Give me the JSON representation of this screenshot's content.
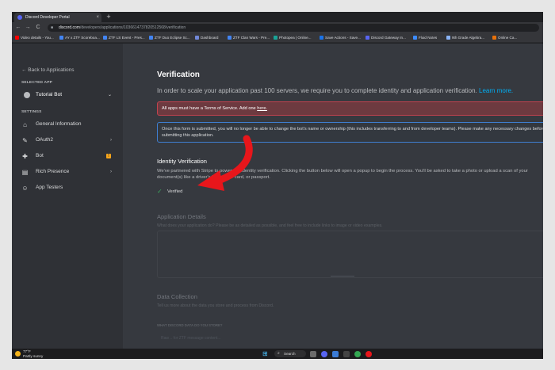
{
  "browser": {
    "tab_title": "Discord Developer Portal",
    "tab_close": "×",
    "new_tab": "+",
    "back": "←",
    "forward": "→",
    "reload": "C",
    "url_host": "discord.com",
    "url_path": "/developers/applications/1036614737820512568/verification",
    "bookmarks": [
      {
        "label": "Video details - You...",
        "color": "#ff0000"
      },
      {
        "label": "AY x ZTF Scoreboa...",
        "color": "#4285f4"
      },
      {
        "label": "ZTF LS Event - Pres...",
        "color": "#4285f4"
      },
      {
        "label": "ZTF Duo Eclipse Sc...",
        "color": "#4285f4"
      },
      {
        "label": "Dashboard",
        "color": "#7289da"
      },
      {
        "label": "ZTF Clan Wars - Pre...",
        "color": "#4285f4"
      },
      {
        "label": "Photopea | Online...",
        "color": "#18a497"
      },
      {
        "label": "Save Actions - Save...",
        "color": "#1a73e8"
      },
      {
        "label": "Discord Gateway In...",
        "color": "#5865f2"
      },
      {
        "label": "Fluid Notes",
        "color": "#3c8cff"
      },
      {
        "label": "9th Grade Algebra...",
        "color": "#8ab4f8"
      },
      {
        "label": "Online Ca...",
        "color": "#e8710a"
      }
    ]
  },
  "sidebar": {
    "back_label": "← Back to Applications",
    "selected_app_label": "SELECTED APP",
    "app_name": "Tutorial Bot",
    "settings_label": "SETTINGS",
    "items": [
      {
        "label": "General Information",
        "icon": "home-icon",
        "glyph": "⌂",
        "arrow": ""
      },
      {
        "label": "OAuth2",
        "icon": "wrench-icon",
        "glyph": "✎",
        "arrow": "›"
      },
      {
        "label": "Bot",
        "icon": "puzzle-icon",
        "glyph": "✚",
        "arrow": "",
        "warn": "!"
      },
      {
        "label": "Rich Presence",
        "icon": "document-icon",
        "glyph": "▤",
        "arrow": "›"
      },
      {
        "label": "App Testers",
        "icon": "person-icon",
        "glyph": "☺",
        "arrow": ""
      }
    ]
  },
  "main": {
    "title": "Verification",
    "intro": "In order to scale your application past 100 servers, we require you to complete identity and application verification.",
    "learn_more": "Learn more.",
    "alert_text": "All apps must have a Terms of Service. Add one ",
    "alert_link": "here.",
    "notice": "Once this form is submitted, you will no longer be able to change the bot's name or ownership (this includes transferring to and from developer teams). Please make any necessary changes before submitting this application.",
    "identity_title": "Identity Verification",
    "identity_text": "We've partnered with Stripe to power our identity verification. Clicking the button below will open a popup to begin the process. You'll be asked to take a photo or upload a scan of your document(s) like a driver's license, ID card, or passport.",
    "verified_label": "Verified",
    "app_details_title": "Application Details",
    "app_details_text": "What does your application do? Please be as detailed as possible, and feel free to include links to image or video examples.",
    "data_collection_title": "Data Collection",
    "data_collection_text": "Tell us more about the data you store and process from Discord.",
    "data_question": "WHAT DISCORD DATA DO YOU STORE?",
    "data_option": "Raw .. for ZTF message content..."
  },
  "taskbar": {
    "temp": "77°F",
    "weather": "Partly sunny",
    "search": "Search"
  },
  "colors": {
    "accent": "#5865f2",
    "arrow": "#e8161b",
    "success": "#3ba55d",
    "link": "#00aff4"
  }
}
